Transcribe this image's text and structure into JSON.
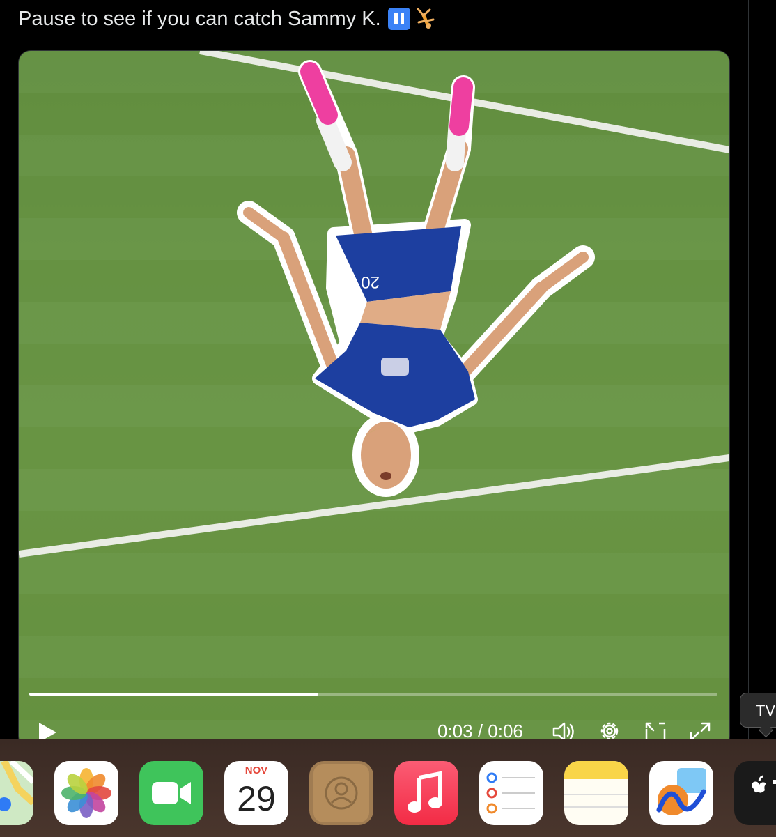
{
  "tweet": {
    "text": "Pause to see if you can catch Sammy K.",
    "emojis": [
      "pause-button-icon",
      "cartwheel-person-icon"
    ]
  },
  "video": {
    "progress_fraction": 0.42,
    "current_time": "0:03",
    "duration": "0:06",
    "time_display": "0:03 / 0:06",
    "shirt_number": "20"
  },
  "tooltip": {
    "text": "TV"
  },
  "dock": {
    "items": [
      {
        "name": "maps-icon"
      },
      {
        "name": "photos-icon"
      },
      {
        "name": "facetime-icon"
      },
      {
        "name": "calendar-icon",
        "month": "NOV",
        "day": "29"
      },
      {
        "name": "contacts-icon"
      },
      {
        "name": "music-icon"
      },
      {
        "name": "reminders-icon"
      },
      {
        "name": "notes-icon"
      },
      {
        "name": "freeform-icon"
      },
      {
        "name": "tv-icon"
      }
    ]
  },
  "colors": {
    "pitch_green": "#6a9648",
    "kit_blue": "#1d3fa0",
    "boot_pink": "#ee3fa0",
    "reminders_blue": "#2f7bf5"
  }
}
